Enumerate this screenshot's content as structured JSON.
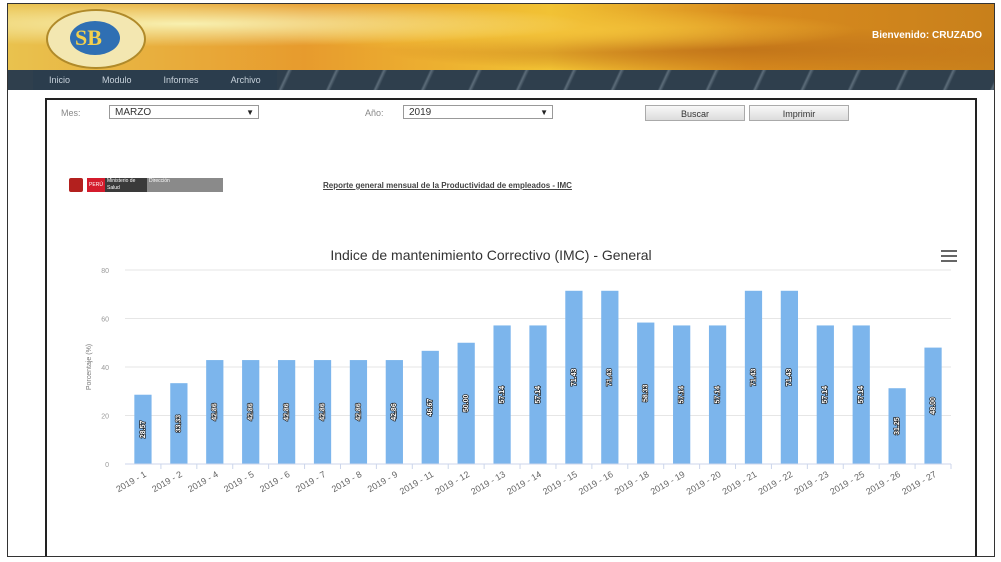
{
  "header": {
    "logo_text": "SB",
    "welcome": "Bienvenido: CRUZADO"
  },
  "nav": {
    "items": [
      "Inicio",
      "Modulo",
      "Informes",
      "Archivo"
    ]
  },
  "filters": {
    "mes_label": "Mes:",
    "mes_value": "MARZO",
    "anio_label": "Año:",
    "anio_value": "2019",
    "buscar": "Buscar",
    "imprimir": "Imprimir"
  },
  "report": {
    "logo_peru": "PERÚ",
    "logo_ministerio": "Ministerio de Salud",
    "logo_direccion": "Dirección",
    "link": "Reporte general mensual de la Productividad de empleados - IMC"
  },
  "colors": {
    "bar": "#7cb5ec",
    "grid": "#e6e6e6"
  },
  "chart_data": {
    "type": "bar",
    "title": "Indice de mantenimiento Correctivo (IMC) - General",
    "ylabel": "Porcentaje (%)",
    "ylim": [
      0,
      80
    ],
    "yticks": [
      0,
      20,
      40,
      60,
      80
    ],
    "categories": [
      "2019 - 1",
      "2019 - 2",
      "2019 - 4",
      "2019 - 5",
      "2019 - 6",
      "2019 - 7",
      "2019 - 8",
      "2019 - 9",
      "2019 - 11",
      "2019 - 12",
      "2019 - 13",
      "2019 - 14",
      "2019 - 15",
      "2019 - 16",
      "2019 - 18",
      "2019 - 19",
      "2019 - 20",
      "2019 - 21",
      "2019 - 22",
      "2019 - 23",
      "2019 - 25",
      "2019 - 26",
      "2019 - 27"
    ],
    "values": [
      28.57,
      33.33,
      42.86,
      42.86,
      42.86,
      42.86,
      42.86,
      42.86,
      46.67,
      50.0,
      57.14,
      57.14,
      71.43,
      71.43,
      58.33,
      57.14,
      57.14,
      71.43,
      71.43,
      57.14,
      57.14,
      31.25,
      48.0
    ]
  }
}
